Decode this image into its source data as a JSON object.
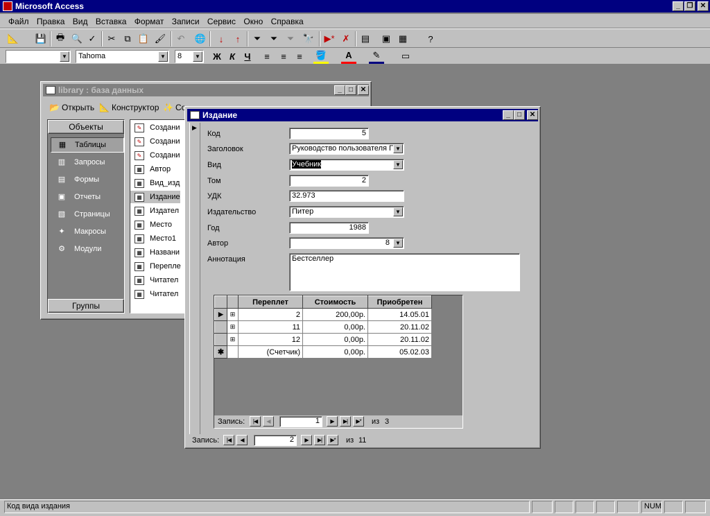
{
  "app": {
    "title": "Microsoft Access"
  },
  "menu": [
    "Файл",
    "Правка",
    "Вид",
    "Вставка",
    "Формат",
    "Записи",
    "Сервис",
    "Окно",
    "Справка"
  ],
  "format_bar": {
    "object_combo": "",
    "font": "Tahoma",
    "size": "8",
    "bold": "Ж",
    "italic": "К",
    "underline": "Ч"
  },
  "db_window": {
    "title": "library : база данных",
    "toolbar": {
      "open": "Открыть",
      "design": "Конструктор",
      "create": "Со"
    },
    "objects_header": "Объекты",
    "groups": "Группы",
    "objects": [
      "Таблицы",
      "Запросы",
      "Формы",
      "Отчеты",
      "Страницы",
      "Макросы",
      "Модули"
    ],
    "list": [
      "Создани",
      "Создани",
      "Создани",
      "Автор",
      "Вид_изд",
      "Издание",
      "Издател",
      "Место",
      "Место1",
      "Названи",
      "Перепле",
      "Читател",
      "Читател"
    ]
  },
  "form": {
    "title": "Издание",
    "fields": {
      "kod": {
        "label": "Код",
        "value": "5"
      },
      "zagolovok": {
        "label": "Заголовок",
        "value": "Руководство пользователя П"
      },
      "vid": {
        "label": "Вид",
        "value": "Учебник"
      },
      "tom": {
        "label": "Том",
        "value": "2"
      },
      "udk": {
        "label": "УДК",
        "value": "32.973"
      },
      "izdatelstvo": {
        "label": "Издательство",
        "value": "Питер"
      },
      "god": {
        "label": "Год",
        "value": "1988"
      },
      "avtor": {
        "label": "Автор",
        "value": "8"
      },
      "annotacia": {
        "label": "Аннотация",
        "value": "Бестселлер"
      }
    },
    "subform": {
      "columns": [
        "Переплет",
        "Стоимость",
        "Приобретен"
      ],
      "rows": [
        [
          "2",
          "200,00р.",
          "14.05.01"
        ],
        [
          "11",
          "0,00р.",
          "20.11.02"
        ],
        [
          "12",
          "0,00р.",
          "20.11.02"
        ],
        [
          "(Счетчик)",
          "0,00р.",
          "05.02.03"
        ]
      ],
      "nav": {
        "label": "Запись:",
        "current": "1",
        "of": "из",
        "total": "3"
      }
    },
    "nav": {
      "label": "Запись:",
      "current": "2",
      "of": "из",
      "total": "11"
    }
  },
  "status": {
    "text": "Код вида издания",
    "num": "NUM"
  }
}
